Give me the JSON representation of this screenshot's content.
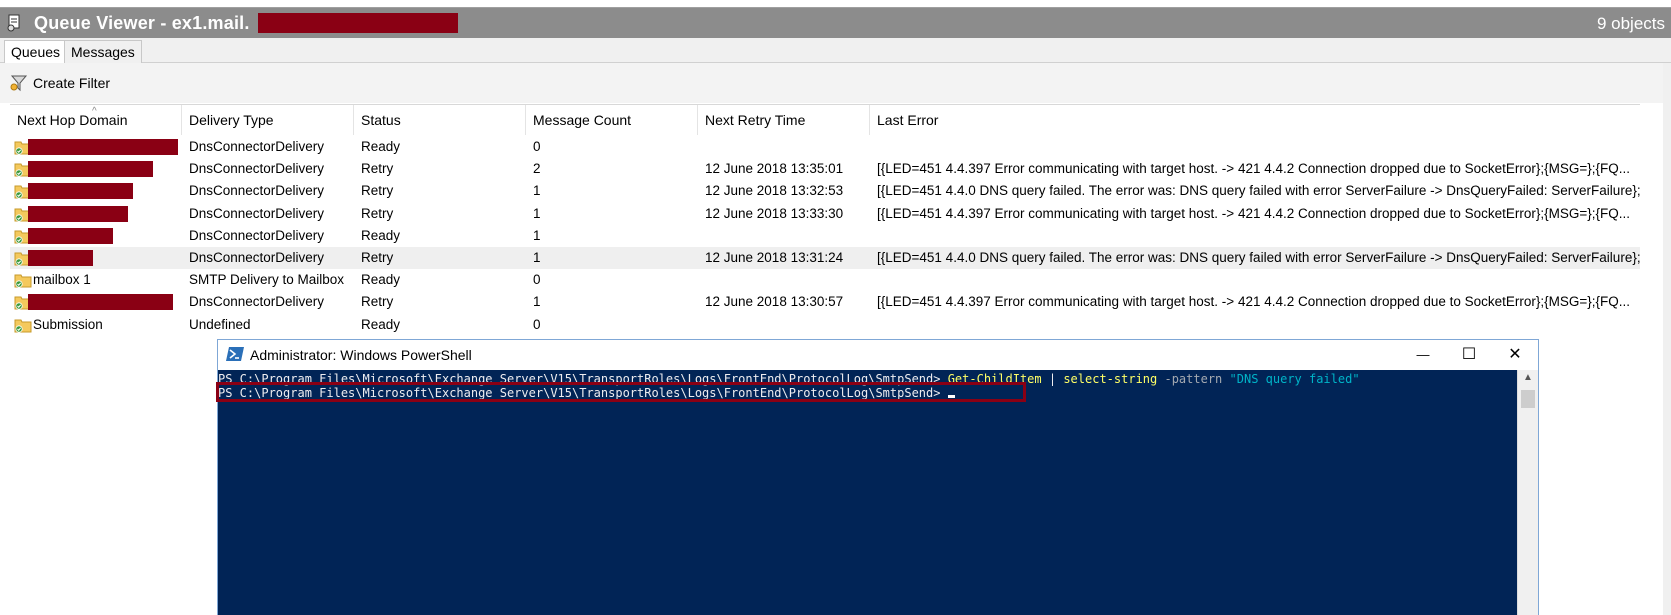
{
  "window": {
    "title": "Queue Viewer - ex1.mail.",
    "object_count": "9 objects"
  },
  "tabs": [
    {
      "label": "Queues",
      "active": true
    },
    {
      "label": "Messages",
      "active": false
    }
  ],
  "toolbar": {
    "create_filter_label": "Create Filter",
    "icon": "funnel-icon"
  },
  "grid": {
    "columns": [
      "Next Hop Domain",
      "Delivery Type",
      "Status",
      "Message Count",
      "Next Retry Time",
      "Last Error"
    ],
    "rows": [
      {
        "domain": "",
        "redacted": true,
        "delivery_type": "DnsConnectorDelivery",
        "status": "Ready",
        "message_count": "0",
        "next_retry": "",
        "last_error": ""
      },
      {
        "domain": "",
        "redacted": true,
        "delivery_type": "DnsConnectorDelivery",
        "status": "Retry",
        "message_count": "2",
        "next_retry": "12 June 2018 13:35:01",
        "last_error": "[{LED=451 4.4.397 Error communicating with target host. -> 421 4.4.2 Connection dropped due to SocketError};{MSG=};{FQ..."
      },
      {
        "domain": "",
        "redacted": true,
        "delivery_type": "DnsConnectorDelivery",
        "status": "Retry",
        "message_count": "1",
        "next_retry": "12 June 2018 13:32:53",
        "last_error": "[{LED=451 4.4.0 DNS query failed. The error was: DNS query failed with error ServerFailure -> DnsQueryFailed: ServerFailure};..."
      },
      {
        "domain": "",
        "redacted": true,
        "delivery_type": "DnsConnectorDelivery",
        "status": "Retry",
        "message_count": "1",
        "next_retry": "12 June 2018 13:33:30",
        "last_error": "[{LED=451 4.4.397 Error communicating with target host. -> 421 4.4.2 Connection dropped due to SocketError};{MSG=};{FQ..."
      },
      {
        "domain": "",
        "redacted": true,
        "delivery_type": "DnsConnectorDelivery",
        "status": "Ready",
        "message_count": "1",
        "next_retry": "",
        "last_error": ""
      },
      {
        "domain": "",
        "redacted": true,
        "delivery_type": "DnsConnectorDelivery",
        "status": "Retry",
        "message_count": "1",
        "next_retry": "12 June 2018 13:31:24",
        "last_error": "[{LED=451 4.4.0 DNS query failed. The error was: DNS query failed with error ServerFailure -> DnsQueryFailed: ServerFailure};...",
        "selected": true
      },
      {
        "domain": "mailbox 1",
        "redacted": false,
        "delivery_type": "SMTP Delivery to Mailbox",
        "status": "Ready",
        "message_count": "0",
        "next_retry": "",
        "last_error": ""
      },
      {
        "domain": "",
        "redacted": true,
        "delivery_type": "DnsConnectorDelivery",
        "status": "Retry",
        "message_count": "1",
        "next_retry": "12 June 2018 13:30:57",
        "last_error": "[{LED=451 4.4.397 Error communicating with target host. -> 421 4.4.2 Connection dropped due to SocketError};{MSG=};{FQ..."
      },
      {
        "domain": "Submission",
        "redacted": false,
        "delivery_type": "Undefined",
        "status": "Ready",
        "message_count": "0",
        "next_retry": "",
        "last_error": ""
      }
    ]
  },
  "powershell": {
    "title": "Administrator: Windows PowerShell",
    "line1_prompt": "PS C:\\Program Files\\Microsoft\\Exchange Server\\V15\\TransportRoles\\Logs\\FrontEnd\\ProtocolLog\\SmtpSend>",
    "line1_cmd1": "Get-ChildItem",
    "line1_pipe": "|",
    "line1_cmd2": "select-string",
    "line1_param": "-pattern",
    "line1_string": "\"DNS query failed\"",
    "line2_prompt": "PS C:\\Program Files\\Microsoft\\Exchange Server\\V15\\TransportRoles\\Logs\\FrontEnd\\ProtocolLog\\SmtpSend>",
    "minimize_glyph": "—",
    "maximize_glyph": "☐",
    "close_glyph": "✕"
  },
  "colors": {
    "titlebar": "#8c8c8c",
    "redaction": "#8a0014",
    "console_bg": "#012456"
  }
}
